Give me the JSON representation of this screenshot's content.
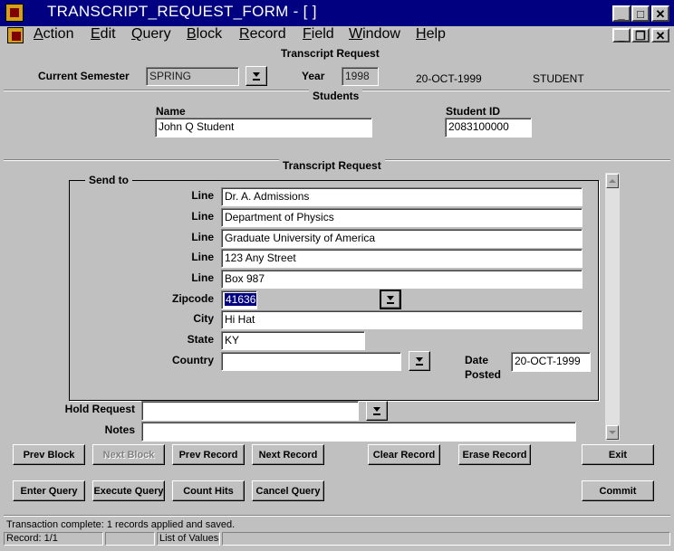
{
  "window": {
    "title": "TRANSCRIPT_REQUEST_FORM - [ ]",
    "app_icon": "forms-app-icon",
    "minimize_glyph": "_",
    "maximize_glyph": "□",
    "close_glyph": "✕",
    "restore_glyph": "❐"
  },
  "menu": {
    "items": [
      "Action",
      "Edit",
      "Query",
      "Block",
      "Record",
      "Field",
      "Window",
      "Help"
    ],
    "underlines": [
      "A",
      "E",
      "Q",
      "B",
      "R",
      "F",
      "W",
      "H"
    ]
  },
  "header": {
    "form_title": "Transcript Request",
    "semester_label": "Current Semester",
    "semester_value": "SPRING",
    "year_label": "Year",
    "year_value": "1998",
    "date_text": "20-OCT-1999",
    "role_text": "STUDENT"
  },
  "students": {
    "section_title": "Students",
    "name_label": "Name",
    "name_value": "John Q Student",
    "id_label": "Student ID",
    "id_value": "2083100000"
  },
  "request": {
    "section_title": "Transcript Request",
    "send_to_label": "Send to",
    "line_label": "Line",
    "lines": [
      "Dr. A. Admissions",
      "Department of Physics",
      "Graduate University of America",
      "123 Any Street",
      "Box 987"
    ],
    "zipcode_label": "Zipcode",
    "zipcode_value": "41636",
    "city_label": "City",
    "city_value": "Hi Hat",
    "state_label": "State",
    "state_value": "KY",
    "country_label": "Country",
    "country_value": "",
    "date_posted_label_1": "Date",
    "date_posted_label_2": "Posted",
    "date_posted_value": "20-OCT-1999",
    "hold_request_label": "Hold Request",
    "hold_request_value": "",
    "notes_label": "Notes",
    "notes_value": ""
  },
  "buttons": {
    "prev_block": "Prev Block",
    "next_block": "Next Block",
    "prev_record": "Prev Record",
    "next_record": "Next Record",
    "clear_record": "Clear Record",
    "erase_record": "Erase Record",
    "exit": "Exit",
    "enter_query": "Enter Query",
    "execute_query": "Execute Query",
    "count_hits": "Count Hits",
    "cancel_query": "Cancel Query",
    "commit": "Commit"
  },
  "status": {
    "message": "Transaction complete: 1 records applied and saved.",
    "record": "Record: 1/1",
    "list_of_values": "List of Values"
  },
  "colors": {
    "titlebar": "#000080",
    "window_bg": "#c0c0c0",
    "selection": "#000080"
  }
}
